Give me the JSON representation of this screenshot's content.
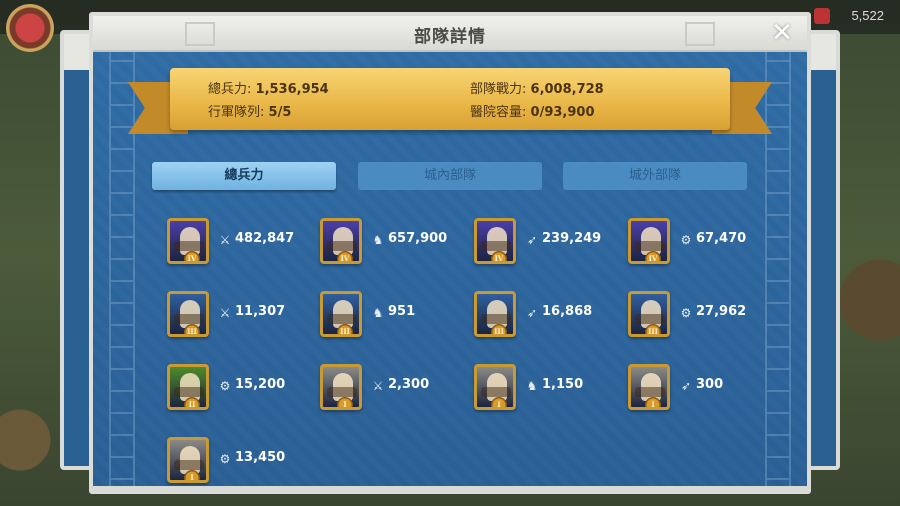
{
  "background": {
    "resource_value": "5,522"
  },
  "dialog": {
    "title": "部隊詳情",
    "close_glyph": "✕"
  },
  "summary": {
    "total_troops_label": "總兵力:",
    "total_troops_value": "1,536,954",
    "march_queue_label": "行軍隊列:",
    "march_queue_value": "5/5",
    "troop_power_label": "部隊戰力:",
    "troop_power_value": "6,008,728",
    "hospital_label": "醫院容量:",
    "hospital_value": "0/93,900"
  },
  "tabs": [
    {
      "label": "總兵力",
      "active": true
    },
    {
      "label": "城內部隊",
      "active": false
    },
    {
      "label": "城外部隊",
      "active": false
    }
  ],
  "units": [
    {
      "count": "482,847",
      "type_icon": "infantry-sword-icon",
      "tier": "IV",
      "color": "#4b3fa8"
    },
    {
      "count": "657,900",
      "type_icon": "cavalry-horse-icon",
      "tier": "IV",
      "color": "#4b3fa8"
    },
    {
      "count": "239,249",
      "type_icon": "archer-bow-icon",
      "tier": "IV",
      "color": "#4b3fa8"
    },
    {
      "count": "67,470",
      "type_icon": "siege-icon",
      "tier": "IV",
      "color": "#4b3fa8"
    },
    {
      "count": "11,307",
      "type_icon": "infantry-sword-icon",
      "tier": "III",
      "color": "#2f5f9e"
    },
    {
      "count": "951",
      "type_icon": "cavalry-horse-icon",
      "tier": "III",
      "color": "#2f5f9e"
    },
    {
      "count": "16,868",
      "type_icon": "archer-bow-icon",
      "tier": "III",
      "color": "#2f5f9e"
    },
    {
      "count": "27,962",
      "type_icon": "siege-icon",
      "tier": "III",
      "color": "#2f5f9e"
    },
    {
      "count": "15,200",
      "type_icon": "siege-icon",
      "tier": "II",
      "color": "#4f8a2a"
    },
    {
      "count": "2,300",
      "type_icon": "infantry-sword-icon",
      "tier": "I",
      "color": "#8a8a86"
    },
    {
      "count": "1,150",
      "type_icon": "cavalry-horse-icon",
      "tier": "I",
      "color": "#8a8a86"
    },
    {
      "count": "300",
      "type_icon": "archer-bow-icon",
      "tier": "I",
      "color": "#8a8a86"
    },
    {
      "count": "13,450",
      "type_icon": "siege-icon",
      "tier": "I",
      "color": "#8a8a86"
    }
  ],
  "colors": {
    "panel_blue": "#2d68a0",
    "ribbon_gold": "#eab94a",
    "tab_active": "#8cc6ee",
    "tab_inactive": "#4a8cc2",
    "icon_frame": "#c99a34"
  }
}
